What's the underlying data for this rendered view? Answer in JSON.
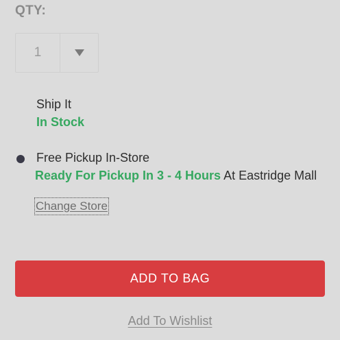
{
  "quantity": {
    "label": "QTY:",
    "value": "1",
    "dropdown_icon": "chevron-down-icon"
  },
  "fulfillment": {
    "ship": {
      "title": "Ship It",
      "status": "In Stock",
      "selected": false
    },
    "pickup": {
      "title": "Free Pickup In-Store",
      "ready_text": "Ready For Pickup In 3 - 4 Hours",
      "location_text": "At Eastridge Mall",
      "selected": true
    },
    "change_store_label": "Change Store"
  },
  "actions": {
    "add_to_bag_label": "ADD TO BAG",
    "wishlist_label": "Add To Wishlist"
  },
  "colors": {
    "background": "#dcdcdc",
    "accent_red": "#d83d40",
    "stock_green": "#36a860",
    "radio_selected": "#3a3a48"
  }
}
